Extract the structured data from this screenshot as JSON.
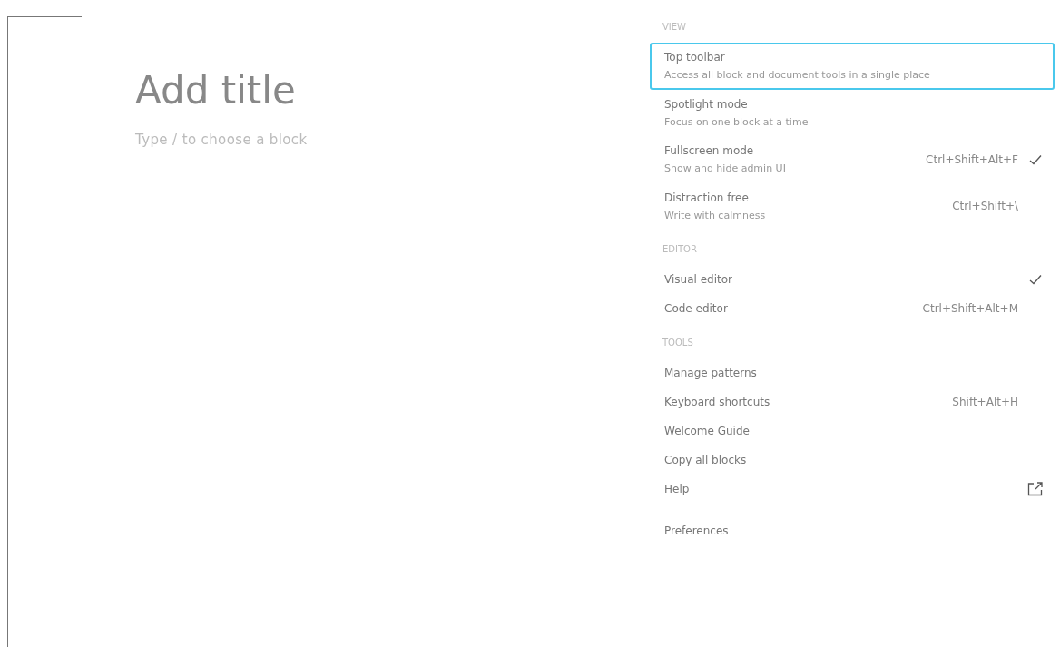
{
  "editor": {
    "title_placeholder": "Add title",
    "block_placeholder": "Type / to choose a block"
  },
  "menu": {
    "groups": [
      {
        "heading": "VIEW",
        "items": [
          {
            "label": "Top toolbar",
            "description": "Access all block and document tools in a single place",
            "checked": false,
            "focused": true,
            "external": false
          },
          {
            "label": "Spotlight mode",
            "description": "Focus on one block at a time",
            "checked": false,
            "focused": false,
            "external": false
          },
          {
            "label": "Fullscreen mode",
            "description": "Show and hide admin UI",
            "shortcut": "Ctrl+Shift+Alt+F",
            "checked": true,
            "focused": false,
            "external": false
          },
          {
            "label": "Distraction free",
            "description": "Write with calmness",
            "shortcut": "Ctrl+Shift+\\",
            "checked": false,
            "focused": false,
            "external": false
          }
        ]
      },
      {
        "heading": "EDITOR",
        "items": [
          {
            "label": "Visual editor",
            "checked": true,
            "focused": false,
            "external": false
          },
          {
            "label": "Code editor",
            "shortcut": "Ctrl+Shift+Alt+M",
            "checked": false,
            "focused": false,
            "external": false
          }
        ]
      },
      {
        "heading": "TOOLS",
        "items": [
          {
            "label": "Manage patterns",
            "checked": false,
            "focused": false,
            "external": false
          },
          {
            "label": "Keyboard shortcuts",
            "shortcut": "Shift+Alt+H",
            "checked": false,
            "focused": false,
            "external": false
          },
          {
            "label": "Welcome Guide",
            "checked": false,
            "focused": false,
            "external": false
          },
          {
            "label": "Copy all blocks",
            "checked": false,
            "focused": false,
            "external": false
          },
          {
            "label": "Help",
            "checked": false,
            "focused": false,
            "external": true
          }
        ]
      },
      {
        "items": [
          {
            "label": "Preferences",
            "checked": false,
            "focused": false,
            "external": false
          }
        ]
      }
    ]
  }
}
